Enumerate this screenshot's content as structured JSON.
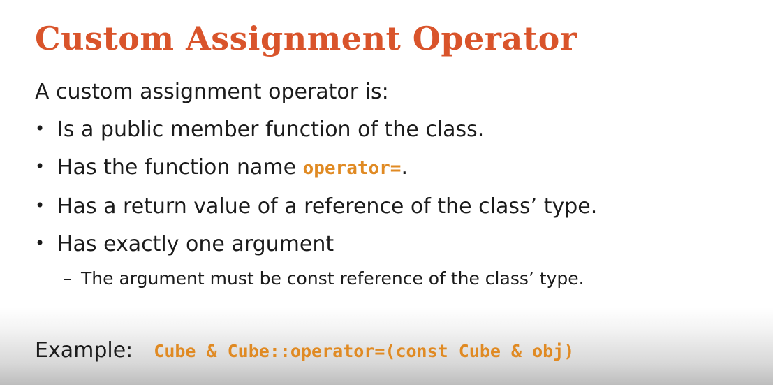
{
  "slide": {
    "title": "Custom Assignment Operator",
    "intro": "A custom assignment operator is:",
    "bullets": [
      {
        "text": "Is a public member function of the class."
      },
      {
        "text_before": "Has the function name ",
        "code": "operator=",
        "text_after": "."
      },
      {
        "text": "Has a return value of a reference of the class’ type."
      },
      {
        "text": "Has exactly one argument"
      }
    ],
    "sub_bullet": "The argument must be const reference of the class’ type.",
    "example_label": "Example:",
    "example_code": "Cube & Cube::operator=(const Cube & obj)"
  },
  "glyphs": {
    "bullet": "•",
    "dash": "–"
  },
  "colors": {
    "title": "#d9542b",
    "code": "#e08a23",
    "text": "#1b1b1b"
  }
}
